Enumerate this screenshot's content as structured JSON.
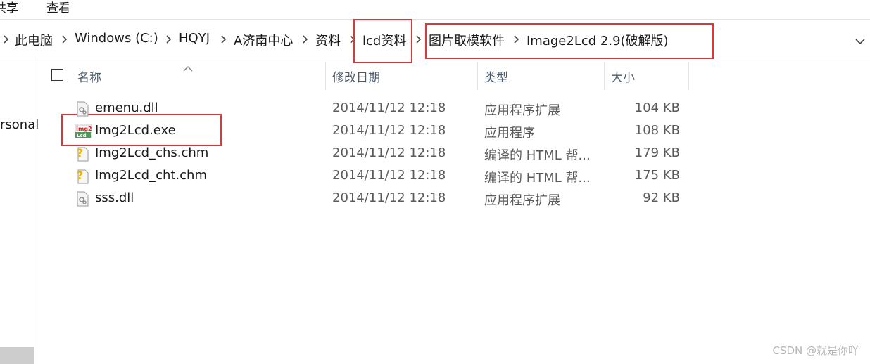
{
  "ribbon": {
    "tabs": [
      "共享",
      "查看"
    ]
  },
  "address": {
    "crumbs": [
      "此电脑",
      "Windows (C:)",
      "HQYJ",
      "A济南中心",
      "资料",
      "lcd资料",
      "图片取模软件",
      "Image2Lcd 2.9(破解版)"
    ]
  },
  "nav": {
    "item": "rsonal"
  },
  "columns": {
    "name": "名称",
    "date": "修改日期",
    "type": "类型",
    "size": "大小"
  },
  "files": [
    {
      "name": "emenu.dll",
      "date": "2014/11/12 12:18",
      "type": "应用程序扩展",
      "size": "104 KB",
      "icon": "dll-icon"
    },
    {
      "name": "Img2Lcd.exe",
      "date": "2014/11/12 12:18",
      "type": "应用程序",
      "size": "108 KB",
      "icon": "exe-icon"
    },
    {
      "name": "Img2Lcd_chs.chm",
      "date": "2014/11/12 12:18",
      "type": "编译的 HTML 帮...",
      "size": "179 KB",
      "icon": "chm-icon"
    },
    {
      "name": "Img2Lcd_cht.chm",
      "date": "2014/11/12 12:18",
      "type": "编译的 HTML 帮...",
      "size": "175 KB",
      "icon": "chm-icon"
    },
    {
      "name": "sss.dll",
      "date": "2014/11/12 12:18",
      "type": "应用程序扩展",
      "size": "92 KB",
      "icon": "dll-icon"
    }
  ],
  "colors": {
    "highlight": "#e0343a",
    "header_text": "#4b5a6b"
  },
  "watermark": "CSDN @就是你吖"
}
